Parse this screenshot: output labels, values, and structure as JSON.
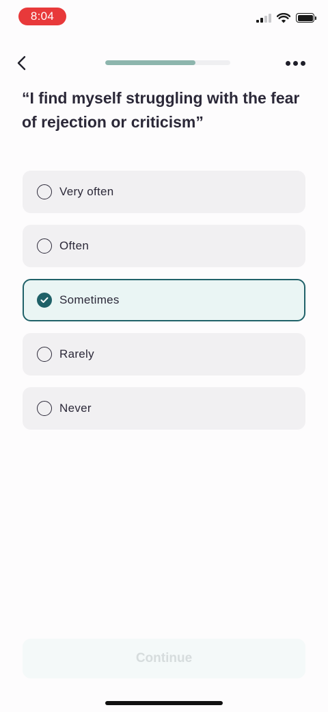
{
  "status_bar": {
    "time": "8:04",
    "time_pill_color": "#e8393a",
    "icons": [
      "cellular-signal-icon",
      "wifi-icon",
      "battery-icon"
    ]
  },
  "nav": {
    "back_icon": "chevron-left-icon",
    "more_icon": "more-horizontal-icon",
    "progress_fraction": 0.72,
    "progress_color": "#8db5ad"
  },
  "question": {
    "text": "“I find myself struggling with the fear of rejection or criticism”"
  },
  "options": [
    {
      "label": "Very often",
      "selected": false
    },
    {
      "label": "Often",
      "selected": false
    },
    {
      "label": "Sometimes",
      "selected": true
    },
    {
      "label": "Rarely",
      "selected": false
    },
    {
      "label": "Never",
      "selected": false
    }
  ],
  "accent_color": "#1f6168",
  "continue_button": {
    "label": "Continue",
    "disabled": true
  }
}
